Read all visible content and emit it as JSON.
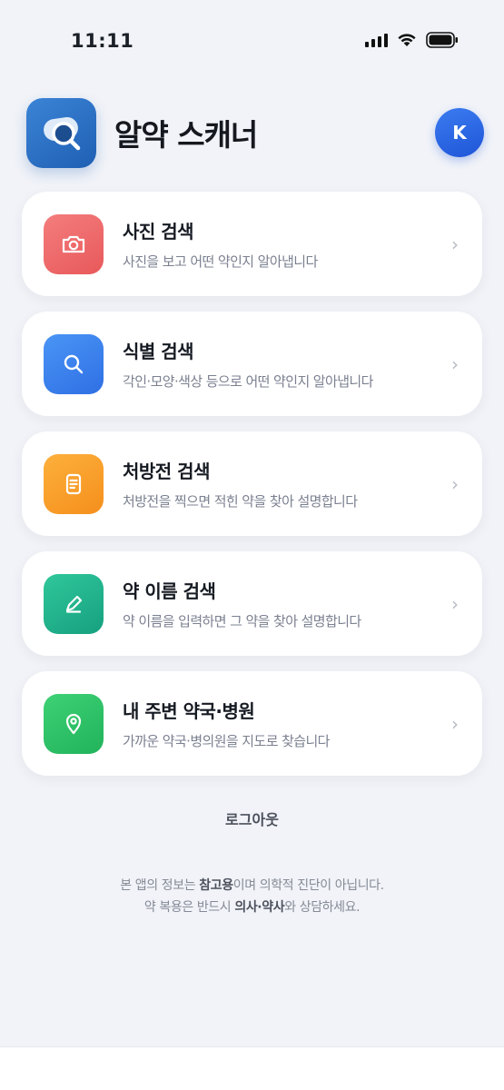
{
  "status_bar": {
    "time": "11:11"
  },
  "header": {
    "title": "알약 스캐너",
    "avatar_initial": "K"
  },
  "menu": [
    {
      "title": "사진 검색",
      "desc": "사진을 보고 어떤 약인지 알아냅니다",
      "icon": "camera-icon",
      "color": "#ef6b6b"
    },
    {
      "title": "식별 검색",
      "desc": "각인·모양·색상 등으로 어떤 약인지 알아냅니다",
      "icon": "search-icon",
      "color": "#3b82f0"
    },
    {
      "title": "처방전 검색",
      "desc": "처방전을 찍으면 적힌 약을 찾아 설명합니다",
      "icon": "document-icon",
      "color": "#f9a02a"
    },
    {
      "title": "약 이름 검색",
      "desc": "약 이름을 입력하면 그 약을 찾아 설명합니다",
      "icon": "pencil-icon",
      "color": "#22b48c"
    },
    {
      "title": "내 주변 약국·병원",
      "desc": "가까운 약국·병의원을 지도로 찾습니다",
      "icon": "location-pin-icon",
      "color": "#2ec267"
    }
  ],
  "logout_label": "로그아웃",
  "disclaimer": {
    "line1_a": "본 앱의 정보는 ",
    "line1_b": "참고용",
    "line1_c": "이며 의학적 진단이 아닙니다.",
    "line2_a": "약 복용은 반드시 ",
    "line2_b": "의사·약사",
    "line2_c": "와 상담하세요."
  }
}
